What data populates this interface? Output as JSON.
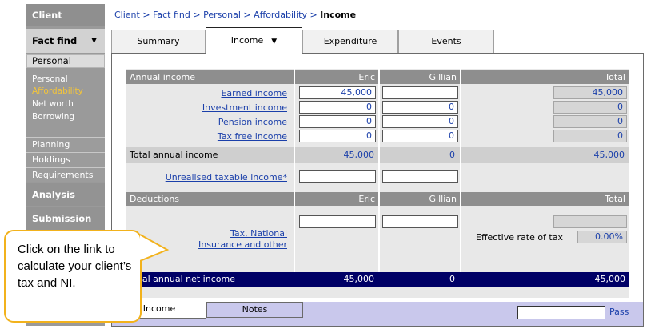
{
  "sidebar": {
    "client": "Client",
    "fact_find": "Fact find",
    "personal_header": "Personal",
    "sub_items": [
      "Personal",
      "Affordability",
      "Net worth",
      "Borrowing"
    ],
    "rows": [
      "Planning",
      "Holdings",
      "Requirements"
    ],
    "analysis": "Analysis",
    "submission": "Submission"
  },
  "breadcrumb": {
    "items": [
      "Client",
      "Fact find",
      "Personal",
      "Affordability"
    ],
    "separator": ">",
    "current": "Income"
  },
  "tabs": [
    "Summary",
    "Income",
    "Expenditure",
    "Events"
  ],
  "annual_income": {
    "header": "Annual income",
    "col_person1": "Eric",
    "col_person2": "Gillian",
    "col_total": "Total",
    "rows": [
      {
        "label": "Earned income",
        "eric": "45,000",
        "gillian": "",
        "total": "45,000"
      },
      {
        "label": "Investment income",
        "eric": "0",
        "gillian": "0",
        "total": "0"
      },
      {
        "label": "Pension income",
        "eric": "0",
        "gillian": "0",
        "total": "0"
      },
      {
        "label": "Tax free income",
        "eric": "0",
        "gillian": "0",
        "total": "0"
      }
    ],
    "total_label": "Total annual income",
    "total_eric": "45,000",
    "total_gillian": "0",
    "total_total": "45,000",
    "unrealised_label": "Unrealised taxable income*"
  },
  "deductions": {
    "header": "Deductions",
    "col_person1": "Eric",
    "col_person2": "Gillian",
    "col_total": "Total",
    "link_line1": "Tax, National",
    "link_line2": "Insurance and other",
    "effective_label": "Effective rate of tax",
    "effective_value": "0.00%"
  },
  "net_income": {
    "label": "Total annual net income",
    "eric": "45,000",
    "gillian": "0",
    "total": "45,000"
  },
  "bottom_tabs": [
    "Income",
    "Notes"
  ],
  "pass_label": "Pass",
  "callout": {
    "text": "Click on the link to calculate your client’s tax and NI."
  }
}
